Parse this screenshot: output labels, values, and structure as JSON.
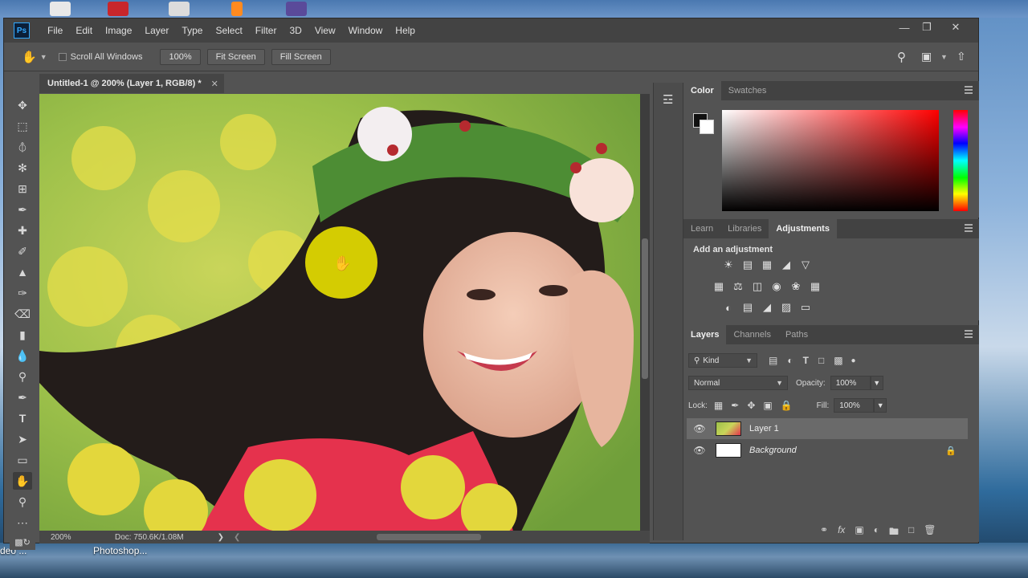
{
  "app": {
    "name": "Ps",
    "menu": [
      "File",
      "Edit",
      "Image",
      "Layer",
      "Type",
      "Select",
      "Filter",
      "3D",
      "View",
      "Window",
      "Help"
    ]
  },
  "desktop": {
    "labels": [
      "deo ...",
      "Photoshop..."
    ]
  },
  "options_bar": {
    "scroll_all_windows": "Scroll All Windows",
    "zoom": "100%",
    "fit_screen": "Fit Screen",
    "fill_screen": "Fill Screen"
  },
  "document": {
    "tab_title": "Untitled-1 @ 200% (Layer 1, RGB/8) *",
    "status_zoom": "200%",
    "status_doc": "Doc: 750.6K/1.08M"
  },
  "color_panel": {
    "tabs": [
      "Color",
      "Swatches"
    ],
    "foreground": "#111111",
    "background": "#ffffff"
  },
  "adjustments_panel": {
    "tabs": [
      "Learn",
      "Libraries",
      "Adjustments"
    ],
    "title": "Add an adjustment",
    "icons_row1": [
      "brightness-icon",
      "levels-icon",
      "curves-icon",
      "exposure-icon",
      "gradient-triangle-icon"
    ],
    "icons_row2": [
      "vibrance-icon",
      "balance-icon",
      "bw-icon",
      "camera-icon",
      "channel-mixer-icon",
      "grid-icon"
    ],
    "icons_row3": [
      "invert-icon",
      "posterize-icon",
      "threshold-icon",
      "selective-color-icon",
      "gradient-map-icon"
    ]
  },
  "layers_panel": {
    "tabs": [
      "Layers",
      "Channels",
      "Paths"
    ],
    "filter_kind": "Kind",
    "blend_mode": "Normal",
    "opacity_label": "Opacity:",
    "opacity_value": "100%",
    "lock_label": "Lock:",
    "fill_label": "Fill:",
    "fill_value": "100%",
    "layers": [
      {
        "name": "Layer 1",
        "visible": true,
        "active": true
      },
      {
        "name": "Background",
        "visible": true,
        "locked": true
      }
    ]
  },
  "accent_colors": {
    "ps_blue": "#31a8ff",
    "cursor_highlight": "#e8e000"
  }
}
